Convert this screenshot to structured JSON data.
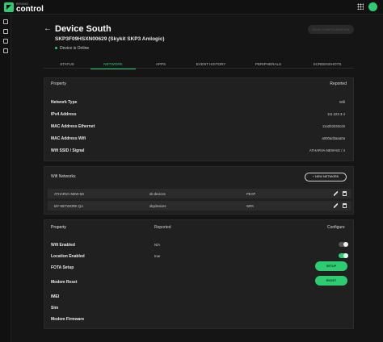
{
  "brand": {
    "small": "BRAND",
    "name": "control"
  },
  "header": {
    "title": "Device South",
    "subtitle": "SKP3F09HSXN00629 (Skykit SKP3 Amlogic)",
    "status": "Device is Online",
    "save_label": "SAVE CONFIGURATION"
  },
  "tabs": [
    "STATUS",
    "NETWORK",
    "APPS",
    "EVENT HISTORY",
    "PERIPHERALS",
    "SCREENSHOTS"
  ],
  "active_tab": "NETWORK",
  "network_info": {
    "col_property": "Property",
    "col_reported": "Reported",
    "rows": [
      {
        "label": "Network Type",
        "value": "Wifi"
      },
      {
        "label": "IPv4 Address",
        "value": "111.222.3.4"
      },
      {
        "label": "MAC Address Ethernet",
        "value": "11a2b3333cd4"
      },
      {
        "label": "MAC Address Wifi",
        "value": "a000ad3aaa0a"
      },
      {
        "label": "Wifi SSID / Signal",
        "value": "ATHARVA-NEW-5G / 4"
      }
    ]
  },
  "wifi_networks": {
    "title": "Wifi Networks",
    "new_button": "+ NEW NETWORK",
    "rows": [
      {
        "ssid": "ATHARVA-NEW-5G",
        "group": "sk-devices",
        "security": "PEAP"
      },
      {
        "ssid": "MY NETWORK QA",
        "group": "skydevices",
        "security": "WPA"
      }
    ]
  },
  "config": {
    "col_property": "Property",
    "col_reported": "Reported",
    "col_configure": "Configure",
    "rows": [
      {
        "label": "Wifi Enabled",
        "reported": "N/A",
        "control": "toggle",
        "state": "off"
      },
      {
        "label": "Location Enabled",
        "reported": "true",
        "control": "toggle",
        "state": "on"
      },
      {
        "label": "FOTA Setup",
        "reported": "",
        "control": "button",
        "button_label": "SETUP"
      },
      {
        "label": "Modem Reset",
        "reported": "",
        "control": "button",
        "button_label": "RESET"
      },
      {
        "label": "IMEI",
        "reported": ""
      },
      {
        "label": "Sim",
        "reported": ""
      },
      {
        "label": "Modem Firmware",
        "reported": ""
      }
    ]
  },
  "colors": {
    "accent": "#2ecc71",
    "bg": "#151515",
    "card": "#202020"
  },
  "icons": [
    "app-grid-icon",
    "back-arrow-icon",
    "edit-icon",
    "trash-icon"
  ]
}
